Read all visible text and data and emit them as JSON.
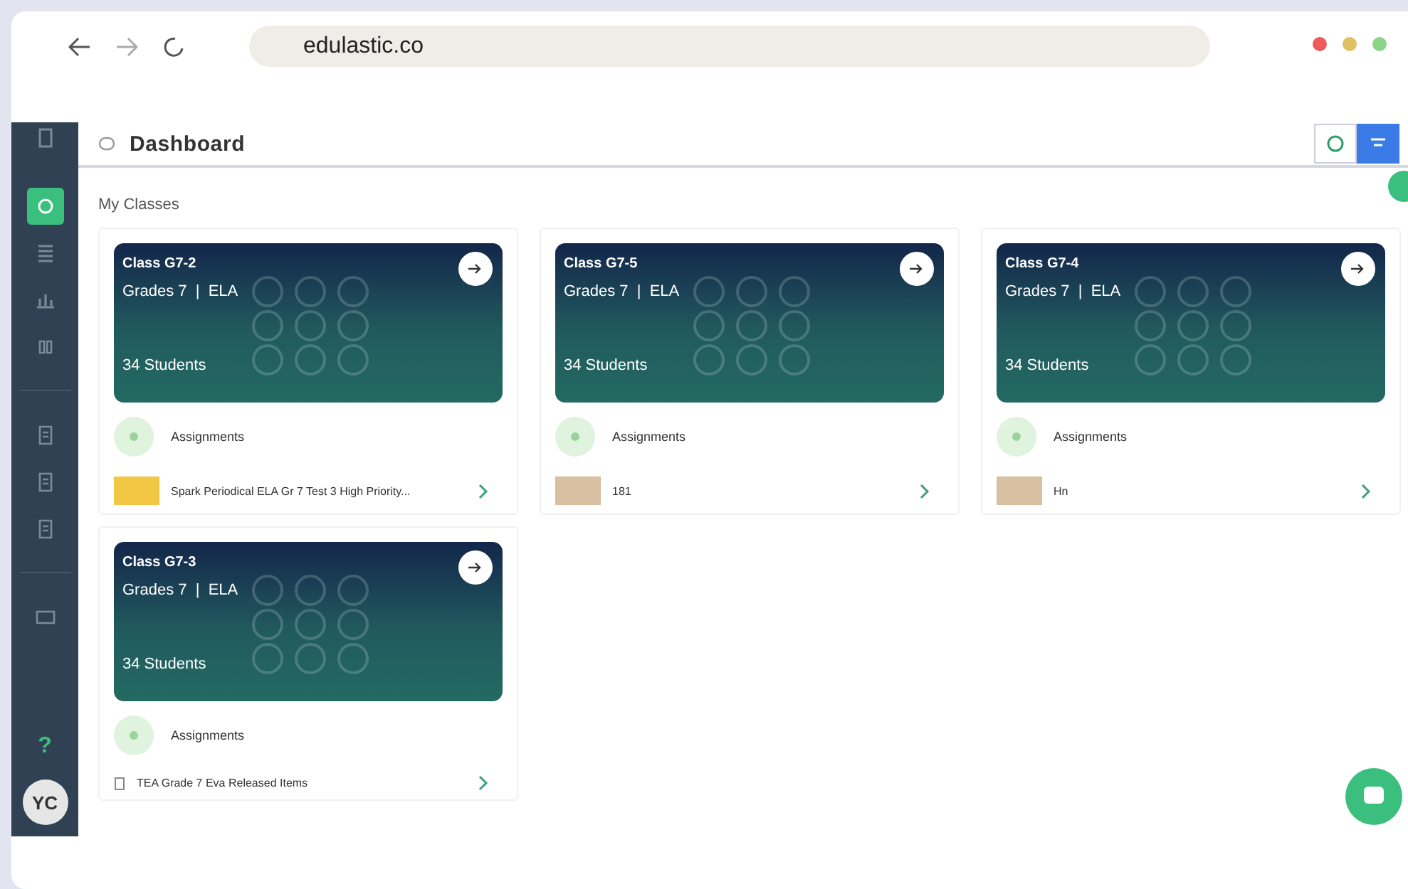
{
  "browser": {
    "url": "edulastic.co"
  },
  "sidebar": {
    "items": [
      {
        "kind": "dashboard",
        "selected": true
      },
      {
        "kind": "list",
        "selected": false
      },
      {
        "kind": "chart",
        "selected": false
      },
      {
        "kind": "grid",
        "selected": false
      },
      {
        "kind": "doc",
        "selected": false
      },
      {
        "kind": "doc",
        "selected": false
      },
      {
        "kind": "doc",
        "selected": false
      },
      {
        "kind": "card",
        "selected": false
      }
    ],
    "help": "?",
    "avatar": "YC"
  },
  "header": {
    "title": "Dashboard"
  },
  "section_title": "My Classes",
  "classes": [
    {
      "name": "Class G7-2",
      "grade": "Grades 7  |  ELA",
      "students": "34 Students",
      "assignments_label": "Assignments",
      "assignment": {
        "title": "Spark Periodical ELA Gr 7 Test 3 High Priority...",
        "kind": "yellow"
      }
    },
    {
      "name": "Class G7-5",
      "grade": "Grades 7  |  ELA",
      "students": "34 Students",
      "assignments_label": "Assignments",
      "assignment": {
        "title": "181",
        "kind": "photo"
      }
    },
    {
      "name": "Class G7-4",
      "grade": "Grades 7  |  ELA",
      "students": "34 Students",
      "assignments_label": "Assignments",
      "assignment": {
        "title": "Hn",
        "kind": "photo"
      }
    },
    {
      "name": "Class G7-3",
      "grade": "Grades 7  |  ELA",
      "students": "34 Students",
      "assignments_label": "Assignments",
      "assignment": {
        "title": "TEA Grade 7 Eva Released Items",
        "kind": "none"
      }
    }
  ]
}
